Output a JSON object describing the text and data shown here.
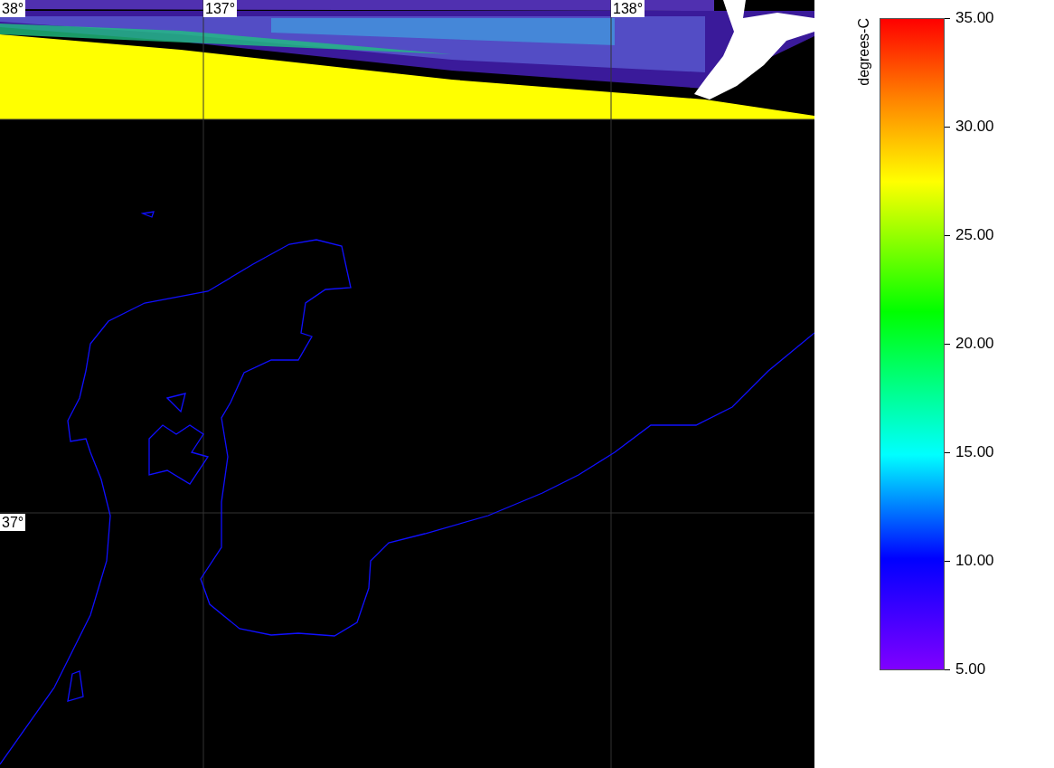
{
  "map": {
    "grid_labels": [
      {
        "text": "38°",
        "kind": "latitude"
      },
      {
        "text": "137°",
        "kind": "longitude"
      },
      {
        "text": "138°",
        "kind": "longitude"
      },
      {
        "text": "37°",
        "kind": "latitude"
      }
    ]
  },
  "legend": {
    "title": "degrees-C",
    "ticks": [
      "35.00",
      "30.00",
      "25.00",
      "20.00",
      "15.00",
      "10.00",
      "5.00"
    ]
  }
}
